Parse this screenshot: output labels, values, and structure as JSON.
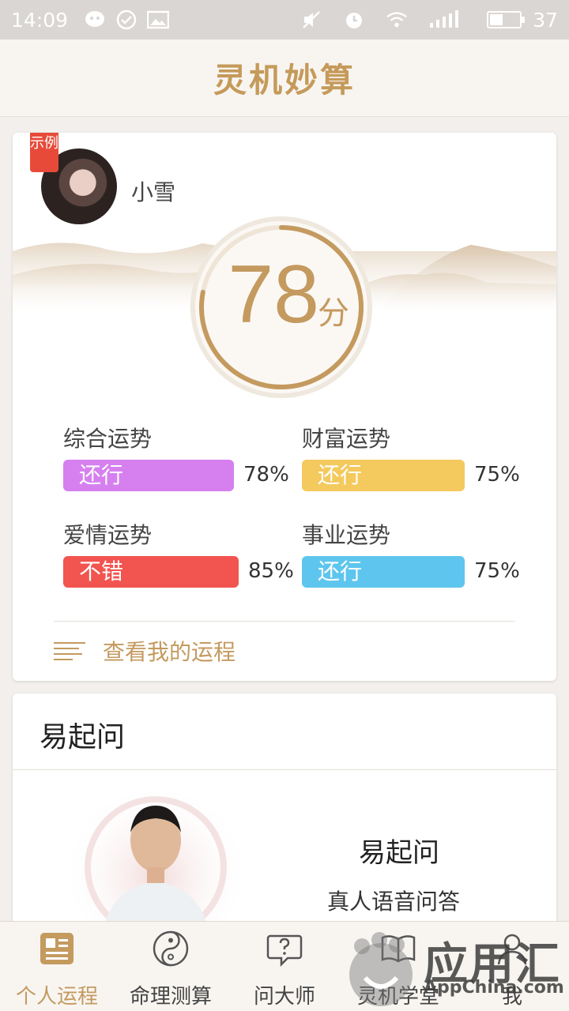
{
  "status_bar": {
    "time": "14:09",
    "battery": "37"
  },
  "header": {
    "title": "灵机妙算"
  },
  "profile": {
    "sample_badge": "示例",
    "name": "小雪",
    "score": "78",
    "score_unit": "分",
    "score_value": 78
  },
  "metrics": [
    {
      "label": "综合运势",
      "status": "还行",
      "percent": "78%",
      "value": 78,
      "color": "#d680f0"
    },
    {
      "label": "财富运势",
      "status": "还行",
      "percent": "75%",
      "value": 75,
      "color": "#f4c95d"
    },
    {
      "label": "爱情运势",
      "status": "不错",
      "percent": "85%",
      "value": 85,
      "color": "#f2544f"
    },
    {
      "label": "事业运势",
      "status": "还行",
      "percent": "75%",
      "value": 75,
      "color": "#5ec6ee"
    }
  ],
  "view_fortune_link": "查看我的运程",
  "master_card": {
    "title": "易起问",
    "name": "易起问",
    "description": "真人语音问答"
  },
  "tabs": [
    {
      "label": "个人运程",
      "icon": "newspaper-icon",
      "active": true
    },
    {
      "label": "命理测算",
      "icon": "yin-yang-icon",
      "active": false
    },
    {
      "label": "问大师",
      "icon": "question-chat-icon",
      "active": false
    },
    {
      "label": "灵机学堂",
      "icon": "book-icon",
      "active": false
    },
    {
      "label": "我",
      "icon": "person-icon",
      "active": false
    }
  ],
  "watermark": {
    "text": "应用汇",
    "sub": "AppChina.com"
  },
  "colors": {
    "accent": "#c49a5f",
    "badge": "#e84a3a"
  }
}
